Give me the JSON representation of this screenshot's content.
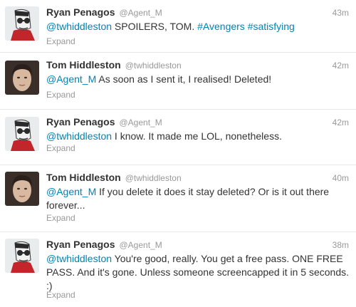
{
  "tweets": [
    {
      "name": "Ryan Penagos",
      "handle": "@Agent_M",
      "time": "43m",
      "avatar": "cartoon-avatar",
      "parts": [
        "@twhiddleston",
        " SPOILERS, TOM. ",
        "#Avengers",
        " ",
        "#satisfying"
      ],
      "expand": "Expand"
    },
    {
      "name": "Tom Hiddleston",
      "handle": "@twhiddleston",
      "time": "42m",
      "avatar": "photo-avatar",
      "parts": [
        "@Agent_M",
        " As soon as I sent it, I realised! Deleted!"
      ],
      "expand": "Expand"
    },
    {
      "name": "Ryan Penagos",
      "handle": "@Agent_M",
      "time": "42m",
      "avatar": "cartoon-avatar",
      "parts": [
        "@twhiddleston",
        " I know. It made me LOL, nonetheless."
      ],
      "expand": "Expand"
    },
    {
      "name": "Tom Hiddleston",
      "handle": "@twhiddleston",
      "time": "40m",
      "avatar": "photo-avatar",
      "parts": [
        "@Agent_M",
        " If you delete it does it stay deleted? Or is it out there forever..."
      ],
      "expand": "Expand"
    },
    {
      "name": "Ryan Penagos",
      "handle": "@Agent_M",
      "time": "38m",
      "avatar": "cartoon-avatar",
      "parts": [
        "@twhiddleston",
        " You're good, really. You get a free pass. ONE FREE PASS. And it's gone. Unless someone screencapped it in 5 seconds. :)"
      ],
      "expand": "Expand"
    }
  ],
  "colors": {
    "link": "#0084b4",
    "name": "#333333",
    "meta": "#999999",
    "divider": "#e8e8e8"
  }
}
